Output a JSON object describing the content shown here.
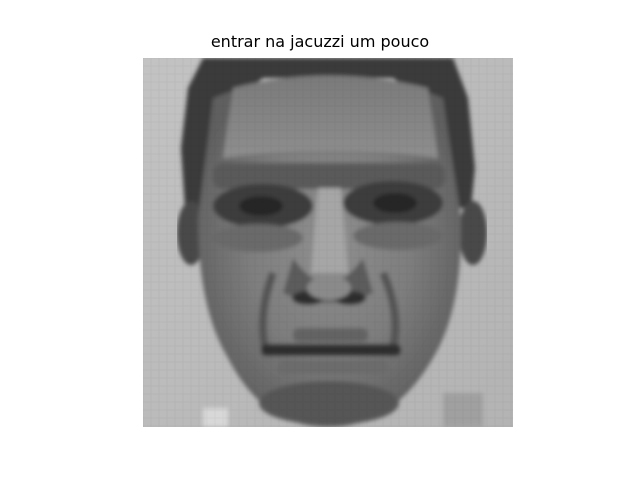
{
  "figure": {
    "title": "entrar na jacuzzi um pouco"
  },
  "image": {
    "subject": "grayscale-face-photo",
    "colormap": "gray",
    "background_color": "#bdbdbd"
  }
}
